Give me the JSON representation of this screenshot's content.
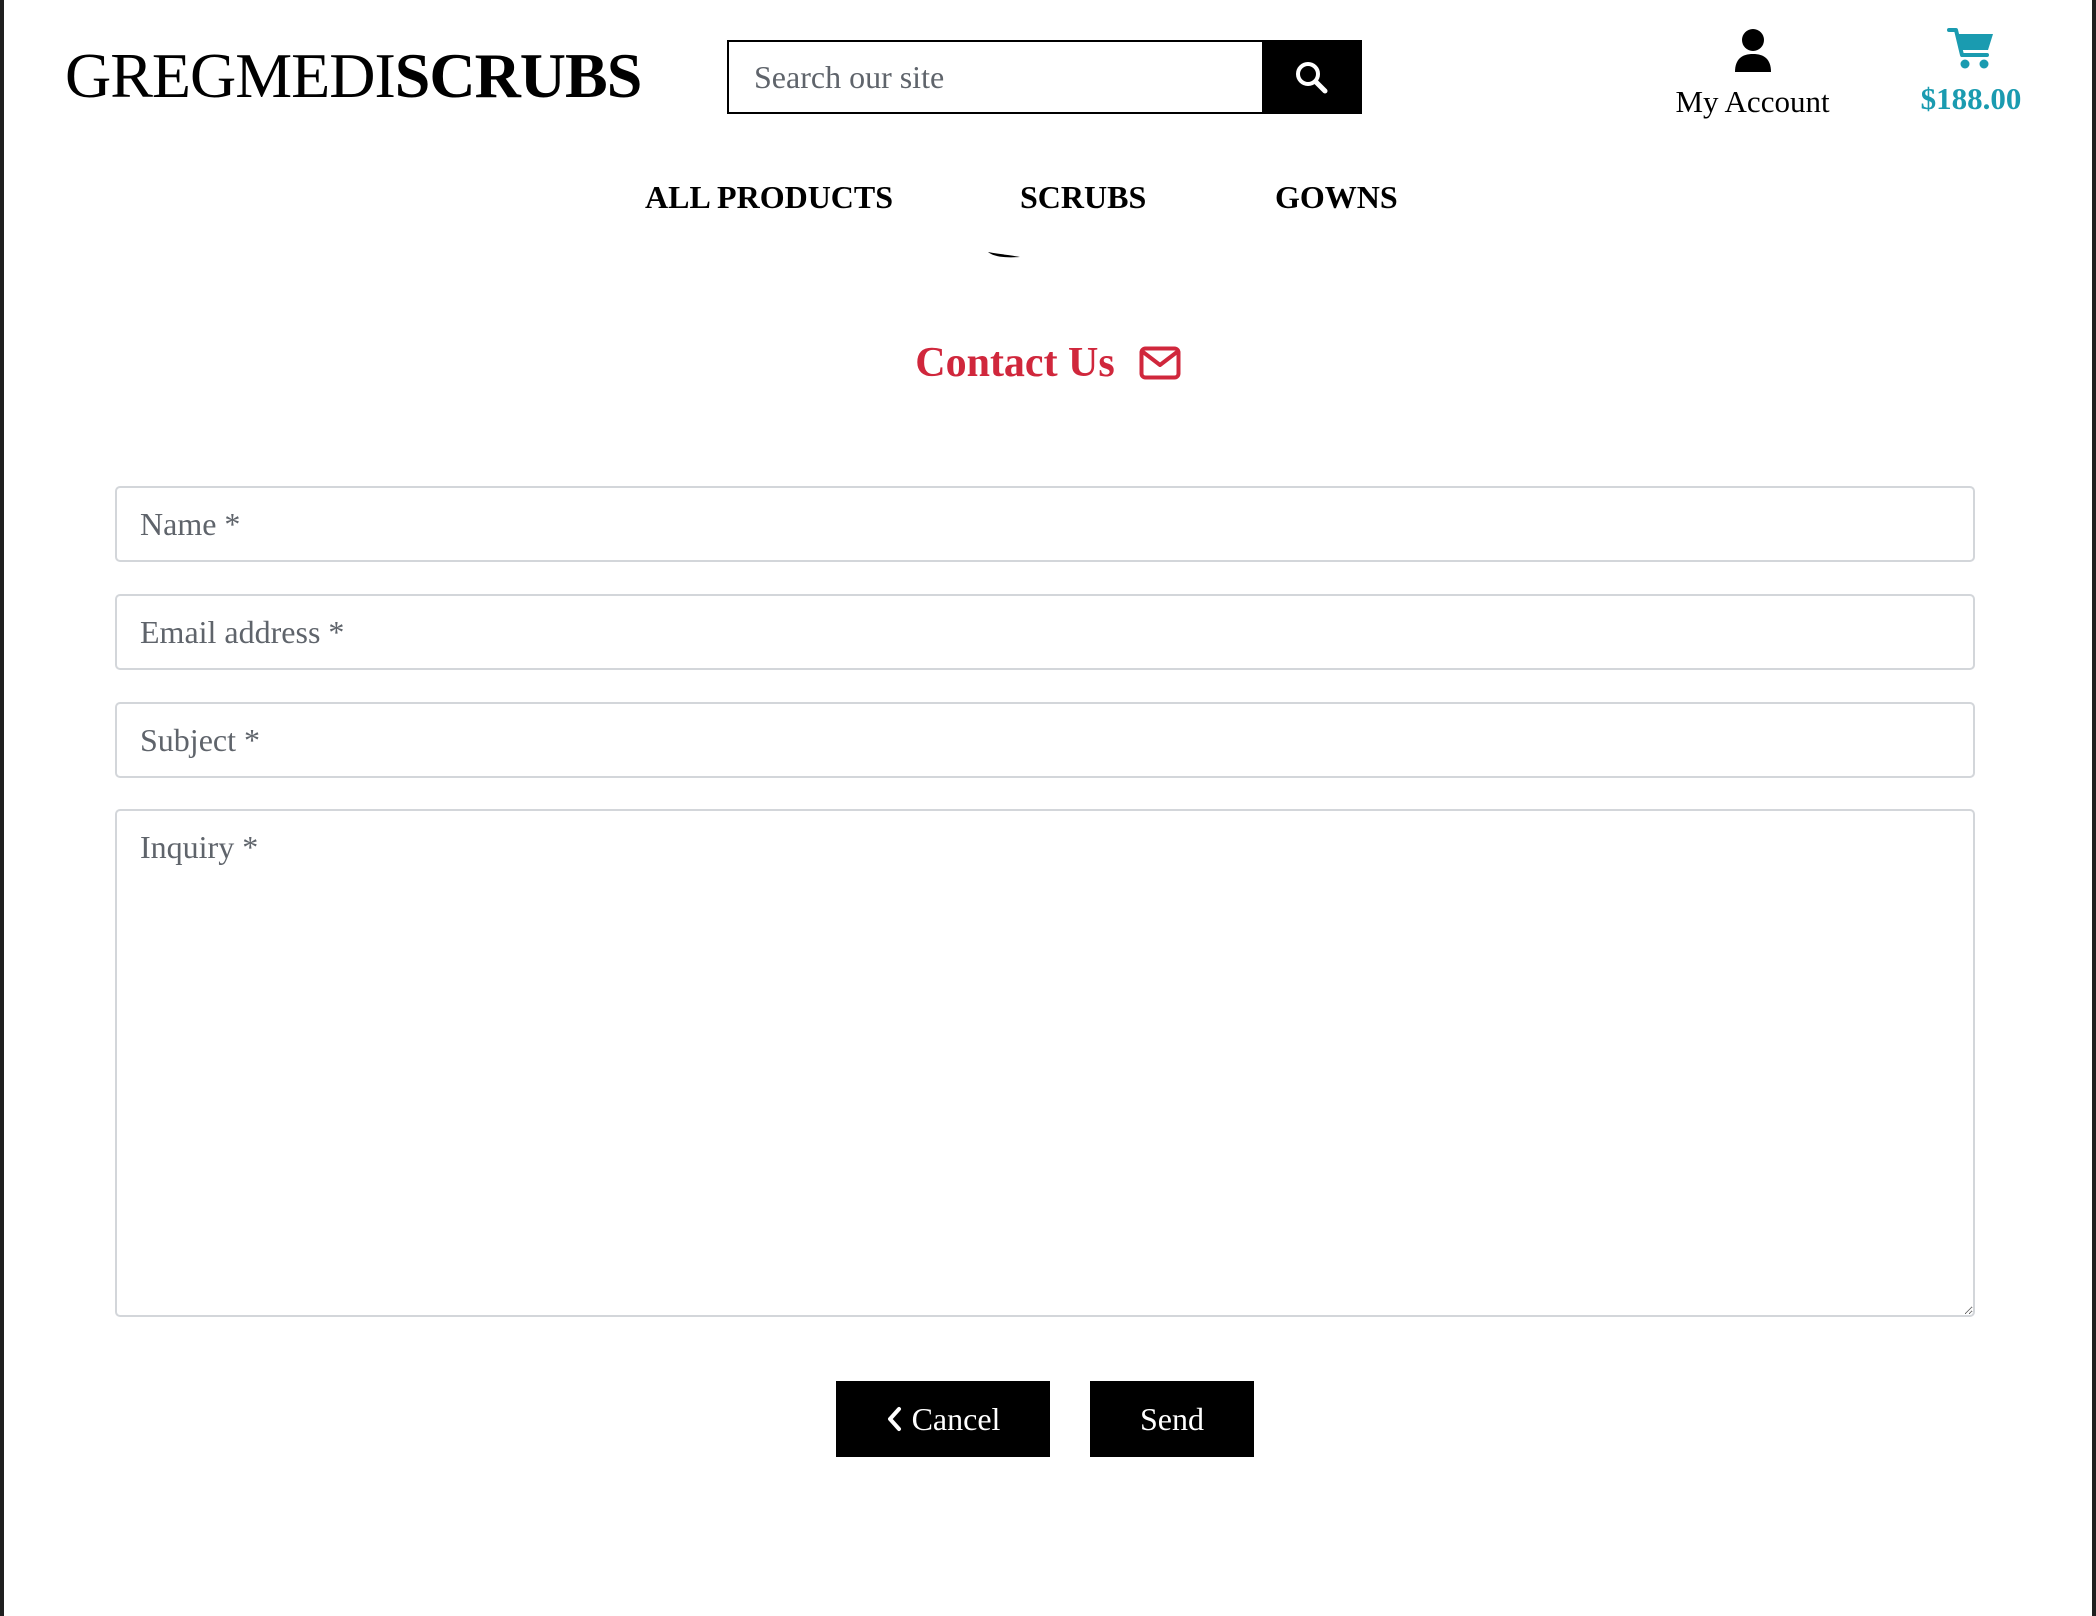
{
  "header": {
    "logo": {
      "regular": "GREGMEDI",
      "bold": "SCRUBS"
    },
    "search": {
      "placeholder": "Search our site",
      "value": "",
      "button_icon": "search-icon"
    },
    "account": {
      "label": "My Account",
      "icon": "user-icon"
    },
    "cart": {
      "total": "$188.00",
      "icon": "shopping-cart-icon",
      "color": "#1a9bb0"
    }
  },
  "nav": {
    "items": [
      {
        "label": "ALL PRODUCTS"
      },
      {
        "label": "SCRUBS"
      },
      {
        "label": "GOWNS"
      }
    ]
  },
  "contact": {
    "title": "Contact Us",
    "title_icon": "envelope-icon",
    "title_color": "#d0273c",
    "fields": {
      "name": {
        "placeholder": "Name *",
        "value": ""
      },
      "email": {
        "placeholder": "Email address *",
        "value": ""
      },
      "subject": {
        "placeholder": "Subject *",
        "value": ""
      },
      "inquiry": {
        "placeholder": "Inquiry *",
        "value": ""
      }
    },
    "buttons": {
      "cancel": {
        "label": "Cancel",
        "icon": "chevron-left-icon"
      },
      "send": {
        "label": "Send"
      }
    }
  }
}
